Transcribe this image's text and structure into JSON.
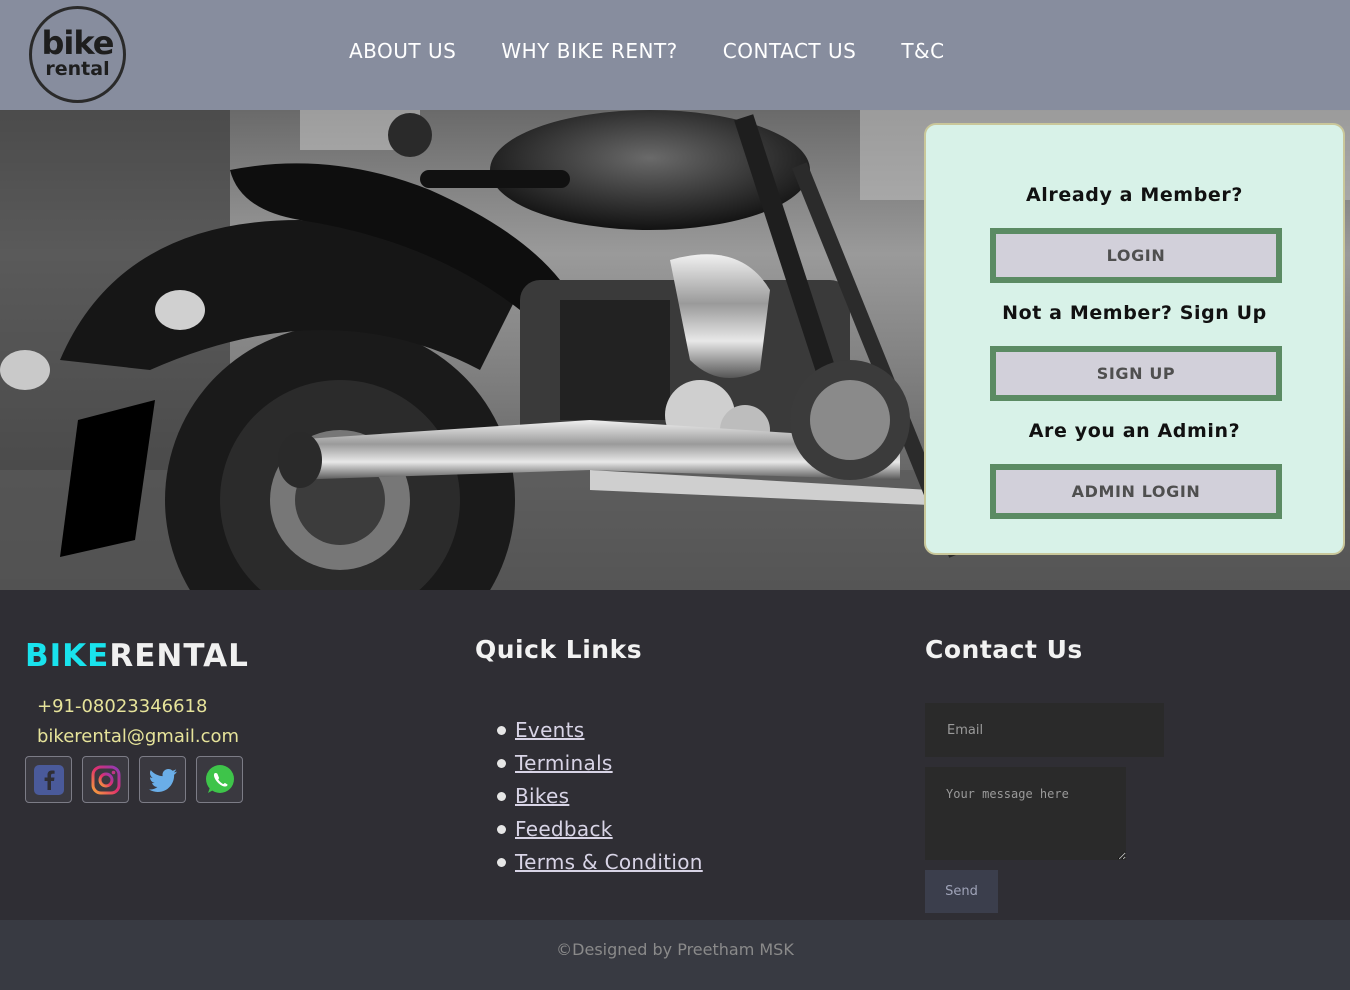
{
  "header": {
    "logo": {
      "line1": "bike",
      "line2": "rental"
    },
    "nav": [
      "ABOUT US",
      "WHY BIKE RENT?",
      "CONTACT US",
      "T&C"
    ]
  },
  "member_card": {
    "member_heading": "Already a Member?",
    "login_label": "LOGIN",
    "signup_heading": "Not a Member? Sign Up",
    "signup_label": "SIGN UP",
    "admin_heading": "Are you an Admin?",
    "admin_label": "ADMIN LOGIN"
  },
  "footer": {
    "brand_part1": "BIKE",
    "brand_part2": "RENTAL",
    "phone": "+91-08023346618",
    "email": "bikerental@gmail.com",
    "social_icons": [
      "facebook-icon",
      "instagram-icon",
      "twitter-icon",
      "whatsapp-icon"
    ],
    "quick_links_title": "Quick Links",
    "quick_links": [
      "Events",
      "Terminals",
      "Bikes",
      "Feedback",
      "Terms & Condition"
    ],
    "contact_title": "Contact Us",
    "email_placeholder": "Email",
    "message_placeholder": "Your message here",
    "send_label": "Send"
  },
  "copyright": "©Designed by Preetham MSK",
  "colors": {
    "header_bg": "#878d9e",
    "card_bg": "#d8f2e8",
    "button_border": "#5b8b63",
    "brand_accent": "#19e3ed",
    "contact_text": "#e6e39a",
    "footer_bg": "#2f2e34"
  }
}
